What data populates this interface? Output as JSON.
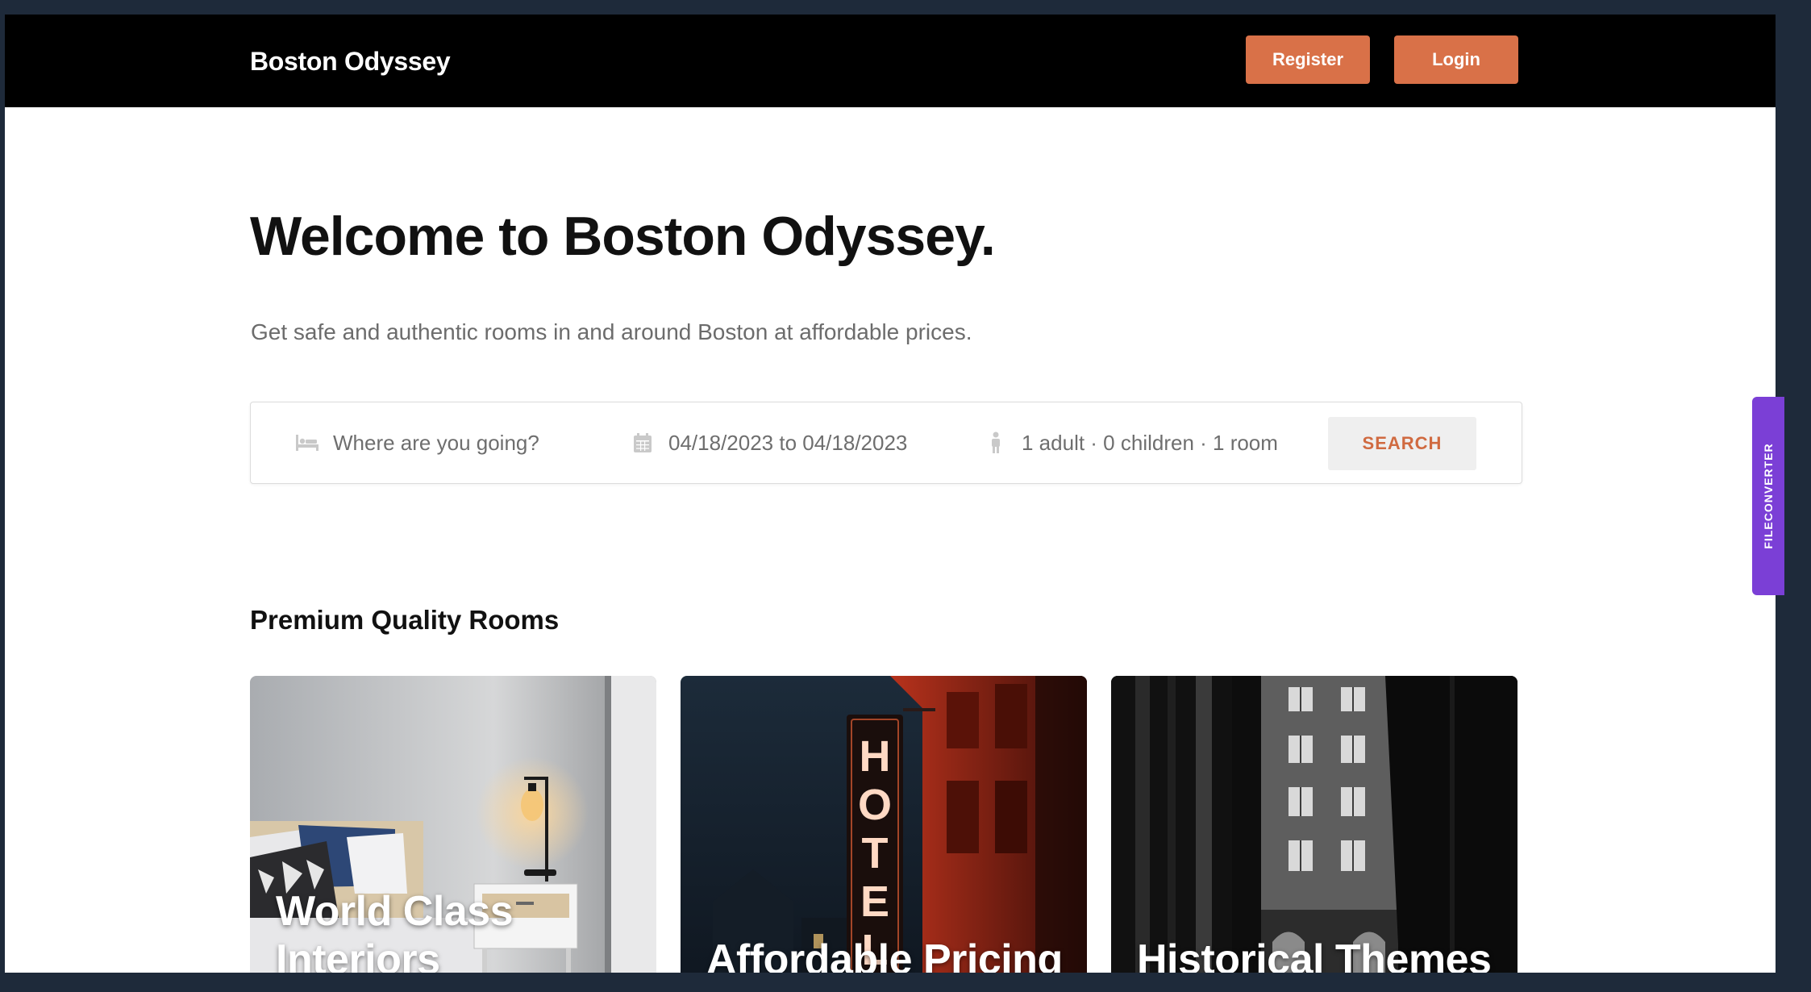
{
  "header": {
    "brand": "Boston Odyssey",
    "register_label": "Register",
    "login_label": "Login"
  },
  "hero": {
    "title": "Welcome to Boston Odyssey.",
    "subtitle": "Get safe and authentic rooms in and around Boston at affordable prices."
  },
  "search": {
    "destination_placeholder": "Where are you going?",
    "dates": "04/18/2023 to 04/18/2023",
    "guests": "1 adult · 0 children · 1 room",
    "button_label": "SEARCH"
  },
  "rooms": {
    "section_title": "Premium Quality Rooms",
    "cards": [
      {
        "label": "World Class Interiors"
      },
      {
        "label": "Affordable Pricing"
      },
      {
        "label": "Historical Themes"
      }
    ]
  },
  "side_tab": {
    "label": "FILECONVERTER"
  },
  "colors": {
    "accent": "#d97148",
    "navbar": "#000000",
    "side_tab": "#7b3fd6"
  },
  "icons": {
    "destination": "bed-icon",
    "dates": "calendar-icon",
    "guests": "person-icon"
  }
}
